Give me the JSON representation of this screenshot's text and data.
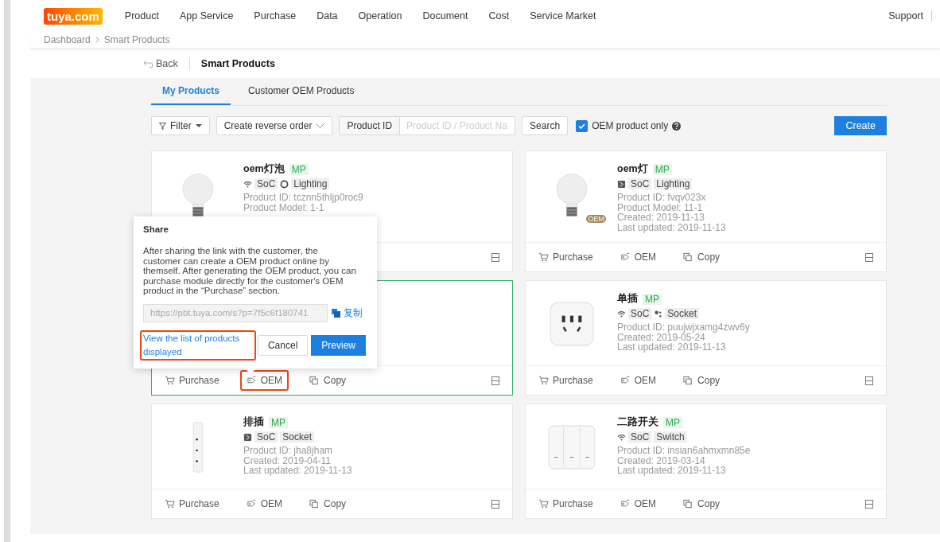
{
  "header": {
    "logo": "tuya.com",
    "nav": [
      "Product",
      "App Service",
      "Purchase",
      "Data",
      "Operation",
      "Document",
      "Cost",
      "Service Market"
    ],
    "support": "Support"
  },
  "breadcrumb": [
    "Dashboard",
    "Smart Products"
  ],
  "subbar": {
    "back": "Back",
    "title": "Smart Products"
  },
  "tabs": [
    {
      "label": "My Products",
      "selected": true
    },
    {
      "label": "Customer OEM Products",
      "selected": false
    }
  ],
  "toolbar": {
    "filter": "Filter",
    "reverse_order": "Create reverse order",
    "search_type": "Product ID",
    "search_placeholder": "Product ID / Product Na",
    "search": "Search",
    "oem_only": {
      "label": "OEM product only",
      "checked": true
    },
    "create": "Create"
  },
  "products": [
    {
      "kind": "bulb",
      "name": "oem灯泡",
      "badge": "MP",
      "tags": [
        {
          "kind": "wifi",
          "label": "SoC"
        },
        {
          "kind": "ring",
          "label": "Lighting"
        }
      ],
      "info": [
        "Product ID: tcznn5thljp0roc9",
        "Product Model: 1-1"
      ],
      "selected": false
    },
    {
      "kind": "bulb",
      "oem_badge": "OEM",
      "name": "oem灯",
      "badge": "MP",
      "tags": [
        {
          "kind": "chip",
          "label": "SoC"
        },
        {
          "kind": "plain",
          "label": "Lighting"
        }
      ],
      "info": [
        "Product ID: fvqv023x",
        "Product Model: 11-1",
        "Created: 2019-11-13",
        "Last updated: 2019-11-13"
      ],
      "actions": [
        {
          "kind": "cart",
          "label": "Purchase",
          "highlighted": false
        },
        {
          "kind": "oem",
          "label": "OEM",
          "highlighted": false
        },
        {
          "kind": "copy",
          "label": "Copy",
          "highlighted": false
        }
      ],
      "selected": false
    },
    {
      "actions": [
        {
          "kind": "cart",
          "label": "Purchase",
          "highlighted": false
        },
        {
          "kind": "oem",
          "label": "OEM",
          "highlighted": true
        },
        {
          "kind": "copy",
          "label": "Copy",
          "highlighted": false
        }
      ],
      "selected": true
    },
    {
      "kind": "socket",
      "name": "单插",
      "badge": "MP",
      "tags": [
        {
          "kind": "wifi",
          "label": "SoC"
        },
        {
          "kind": "dots",
          "label": "Socket"
        }
      ],
      "info": [
        "Product ID: puujwjxamg4zwv6y",
        "Created: 2019-05-24",
        "Last updated: 2019-11-13"
      ],
      "actions": [
        {
          "kind": "cart",
          "label": "Purchase",
          "highlighted": false
        },
        {
          "kind": "oem",
          "label": "OEM",
          "highlighted": false
        },
        {
          "kind": "copy",
          "label": "Copy",
          "highlighted": false
        }
      ],
      "selected": false
    },
    {
      "kind": "strip",
      "name": "排插",
      "badge": "MP",
      "tags": [
        {
          "kind": "chip",
          "label": "SoC"
        },
        {
          "kind": "plain",
          "label": "Socket"
        }
      ],
      "info": [
        "Product ID: jha8jham",
        "Created: 2019-04-11",
        "Last updated: 2019-11-13"
      ],
      "actions": [
        {
          "kind": "cart",
          "label": "Purchase",
          "highlighted": false
        },
        {
          "kind": "oem",
          "label": "OEM",
          "highlighted": false
        },
        {
          "kind": "copy",
          "label": "Copy",
          "highlighted": false
        }
      ],
      "selected": false
    },
    {
      "kind": "switch",
      "name": "二路开关",
      "badge": "MP",
      "tags": [
        {
          "kind": "wifi",
          "label": "SoC"
        },
        {
          "kind": "plain",
          "label": "Switch"
        }
      ],
      "info": [
        "Product ID: insian6ahmxmn85e",
        "Created: 2019-03-14",
        "Last updated: 2019-11-13"
      ],
      "actions": [
        {
          "kind": "cart",
          "label": "Purchase",
          "highlighted": false
        },
        {
          "kind": "oem",
          "label": "OEM",
          "highlighted": false
        },
        {
          "kind": "copy",
          "label": "Copy",
          "highlighted": false
        }
      ],
      "selected": false
    }
  ],
  "share_popup": {
    "title": "Share",
    "text": "After sharing the link with the customer, the customer can create a OEM product online by themself. After generating the OEM product, you can purchase module directly for the customer's OEM product in the “Purchase” section.",
    "link": "https://pbt.tuya.com/s?p=7f5c6f180741",
    "copy": "复制",
    "view_list": {
      "label": "View the list of products displayed",
      "highlighted": true
    },
    "cancel": "Cancel",
    "preview": "Preview"
  }
}
